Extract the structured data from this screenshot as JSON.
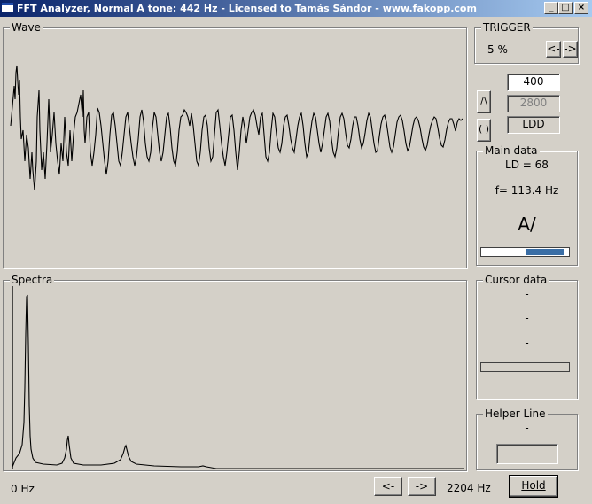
{
  "window": {
    "title": "FFT Analyzer, Normal A tone: 442 Hz - Licensed to Tamás Sándor - www.fakopp.com",
    "minimize_glyph": "_",
    "maximize_glyph": "□",
    "close_glyph": "×"
  },
  "wave": {
    "label": "Wave"
  },
  "spectra": {
    "label": "Spectra"
  },
  "trigger": {
    "label": "TRIGGER",
    "value": "5 %",
    "left_button": "<-",
    "right_button": "->"
  },
  "settings": {
    "field1": "400",
    "field2": "2800",
    "field3": "LDD",
    "mode_button_glyph": "/\\",
    "ear_button_glyph": "( )"
  },
  "main_data": {
    "label": "Main data",
    "ld": "LD = 68",
    "freq": "f= 113.4 Hz",
    "symbol": "A/",
    "level_fraction": 0.43
  },
  "cursor_data": {
    "label": "Cursor data",
    "line1": "-",
    "line2": "-",
    "line3": "-"
  },
  "helper_line": {
    "label": "Helper Line",
    "value": "-",
    "input_value": ""
  },
  "footer": {
    "freq_start": "0 Hz",
    "freq_end": "2204 Hz",
    "prev_button": "<-",
    "next_button": "->",
    "hold_button": "Hold"
  },
  "colors": {
    "face": "#d4d0c8",
    "title_start": "#0a246a",
    "title_end": "#a6caf0",
    "level_bar": "#3a6ea5"
  }
}
